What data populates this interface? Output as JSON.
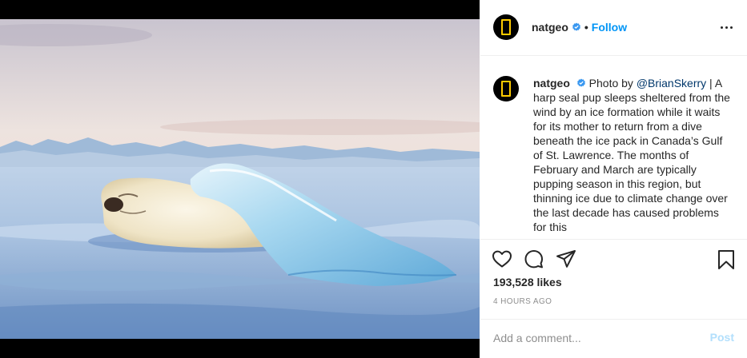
{
  "post": {
    "username": "natgeo",
    "follow_label": "Follow",
    "separator": "•",
    "caption": {
      "username": "natgeo",
      "text_prefix": "Photo by ",
      "mention": "@BrianSkerry",
      "text_body": " | A harp seal pup sleeps sheltered from the wind by an ice formation while it waits for its mother to return from a dive beneath the ice pack in Canada’s Gulf of St. Lawrence. The months of February and March are typically pupping season in this region, but thinning ice due to climate change over the last decade has caused problems for this"
    },
    "likes_label": "193,528 likes",
    "timestamp": "4 HOURS AGO",
    "comment_placeholder": "Add a comment...",
    "post_label": "Post"
  },
  "icons": {
    "verified": "verified-badge-icon",
    "more": "more-options-icon",
    "like": "heart-icon",
    "comment": "comment-bubble-icon",
    "share": "paper-plane-icon",
    "save": "bookmark-icon"
  },
  "colors": {
    "accent": "#0095f6",
    "mention": "#00376b",
    "secondary_text": "#8e8e8e",
    "post_disabled": "#b2dffc",
    "logo_yellow": "#ffcc00"
  }
}
